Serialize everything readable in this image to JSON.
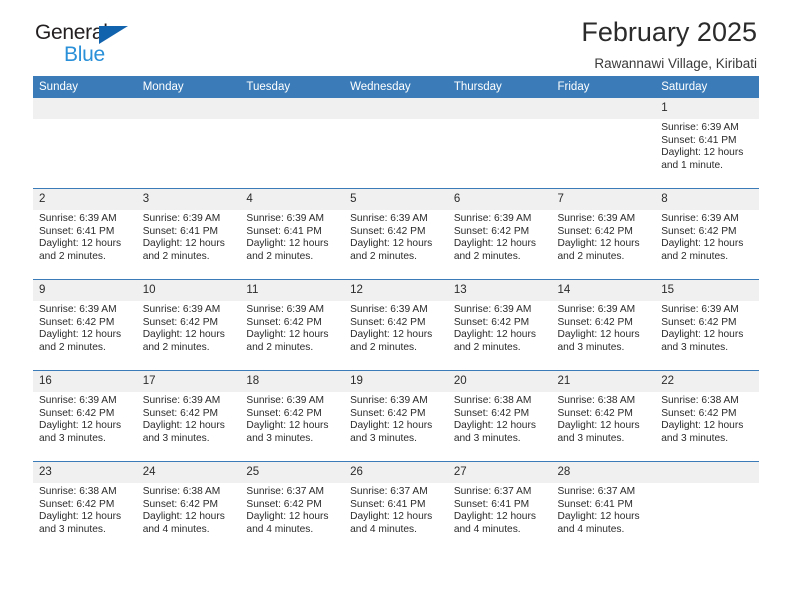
{
  "logo": {
    "word1": "General",
    "word2": "Blue",
    "triangle_color": "#1263ad",
    "word2_color": "#2a90d8"
  },
  "header": {
    "title": "February 2025",
    "subtitle": "Rawannawi Village, Kiribati"
  },
  "theme": {
    "header_blue": "#3b7cb8",
    "daynum_band": "#f0f0f0",
    "text": "#2b2b2b"
  },
  "calendar": {
    "weekday_headers": [
      "Sunday",
      "Monday",
      "Tuesday",
      "Wednesday",
      "Thursday",
      "Friday",
      "Saturday"
    ],
    "weeks": [
      [
        {
          "day": "",
          "sunrise": "",
          "sunset": "",
          "daylight": "",
          "daylight2": ""
        },
        {
          "day": "",
          "sunrise": "",
          "sunset": "",
          "daylight": "",
          "daylight2": ""
        },
        {
          "day": "",
          "sunrise": "",
          "sunset": "",
          "daylight": "",
          "daylight2": ""
        },
        {
          "day": "",
          "sunrise": "",
          "sunset": "",
          "daylight": "",
          "daylight2": ""
        },
        {
          "day": "",
          "sunrise": "",
          "sunset": "",
          "daylight": "",
          "daylight2": ""
        },
        {
          "day": "",
          "sunrise": "",
          "sunset": "",
          "daylight": "",
          "daylight2": ""
        },
        {
          "day": "1",
          "sunrise": "Sunrise: 6:39 AM",
          "sunset": "Sunset: 6:41 PM",
          "daylight": "Daylight: 12 hours",
          "daylight2": "and 1 minute."
        }
      ],
      [
        {
          "day": "2",
          "sunrise": "Sunrise: 6:39 AM",
          "sunset": "Sunset: 6:41 PM",
          "daylight": "Daylight: 12 hours",
          "daylight2": "and 2 minutes."
        },
        {
          "day": "3",
          "sunrise": "Sunrise: 6:39 AM",
          "sunset": "Sunset: 6:41 PM",
          "daylight": "Daylight: 12 hours",
          "daylight2": "and 2 minutes."
        },
        {
          "day": "4",
          "sunrise": "Sunrise: 6:39 AM",
          "sunset": "Sunset: 6:41 PM",
          "daylight": "Daylight: 12 hours",
          "daylight2": "and 2 minutes."
        },
        {
          "day": "5",
          "sunrise": "Sunrise: 6:39 AM",
          "sunset": "Sunset: 6:42 PM",
          "daylight": "Daylight: 12 hours",
          "daylight2": "and 2 minutes."
        },
        {
          "day": "6",
          "sunrise": "Sunrise: 6:39 AM",
          "sunset": "Sunset: 6:42 PM",
          "daylight": "Daylight: 12 hours",
          "daylight2": "and 2 minutes."
        },
        {
          "day": "7",
          "sunrise": "Sunrise: 6:39 AM",
          "sunset": "Sunset: 6:42 PM",
          "daylight": "Daylight: 12 hours",
          "daylight2": "and 2 minutes."
        },
        {
          "day": "8",
          "sunrise": "Sunrise: 6:39 AM",
          "sunset": "Sunset: 6:42 PM",
          "daylight": "Daylight: 12 hours",
          "daylight2": "and 2 minutes."
        }
      ],
      [
        {
          "day": "9",
          "sunrise": "Sunrise: 6:39 AM",
          "sunset": "Sunset: 6:42 PM",
          "daylight": "Daylight: 12 hours",
          "daylight2": "and 2 minutes."
        },
        {
          "day": "10",
          "sunrise": "Sunrise: 6:39 AM",
          "sunset": "Sunset: 6:42 PM",
          "daylight": "Daylight: 12 hours",
          "daylight2": "and 2 minutes."
        },
        {
          "day": "11",
          "sunrise": "Sunrise: 6:39 AM",
          "sunset": "Sunset: 6:42 PM",
          "daylight": "Daylight: 12 hours",
          "daylight2": "and 2 minutes."
        },
        {
          "day": "12",
          "sunrise": "Sunrise: 6:39 AM",
          "sunset": "Sunset: 6:42 PM",
          "daylight": "Daylight: 12 hours",
          "daylight2": "and 2 minutes."
        },
        {
          "day": "13",
          "sunrise": "Sunrise: 6:39 AM",
          "sunset": "Sunset: 6:42 PM",
          "daylight": "Daylight: 12 hours",
          "daylight2": "and 2 minutes."
        },
        {
          "day": "14",
          "sunrise": "Sunrise: 6:39 AM",
          "sunset": "Sunset: 6:42 PM",
          "daylight": "Daylight: 12 hours",
          "daylight2": "and 3 minutes."
        },
        {
          "day": "15",
          "sunrise": "Sunrise: 6:39 AM",
          "sunset": "Sunset: 6:42 PM",
          "daylight": "Daylight: 12 hours",
          "daylight2": "and 3 minutes."
        }
      ],
      [
        {
          "day": "16",
          "sunrise": "Sunrise: 6:39 AM",
          "sunset": "Sunset: 6:42 PM",
          "daylight": "Daylight: 12 hours",
          "daylight2": "and 3 minutes."
        },
        {
          "day": "17",
          "sunrise": "Sunrise: 6:39 AM",
          "sunset": "Sunset: 6:42 PM",
          "daylight": "Daylight: 12 hours",
          "daylight2": "and 3 minutes."
        },
        {
          "day": "18",
          "sunrise": "Sunrise: 6:39 AM",
          "sunset": "Sunset: 6:42 PM",
          "daylight": "Daylight: 12 hours",
          "daylight2": "and 3 minutes."
        },
        {
          "day": "19",
          "sunrise": "Sunrise: 6:39 AM",
          "sunset": "Sunset: 6:42 PM",
          "daylight": "Daylight: 12 hours",
          "daylight2": "and 3 minutes."
        },
        {
          "day": "20",
          "sunrise": "Sunrise: 6:38 AM",
          "sunset": "Sunset: 6:42 PM",
          "daylight": "Daylight: 12 hours",
          "daylight2": "and 3 minutes."
        },
        {
          "day": "21",
          "sunrise": "Sunrise: 6:38 AM",
          "sunset": "Sunset: 6:42 PM",
          "daylight": "Daylight: 12 hours",
          "daylight2": "and 3 minutes."
        },
        {
          "day": "22",
          "sunrise": "Sunrise: 6:38 AM",
          "sunset": "Sunset: 6:42 PM",
          "daylight": "Daylight: 12 hours",
          "daylight2": "and 3 minutes."
        }
      ],
      [
        {
          "day": "23",
          "sunrise": "Sunrise: 6:38 AM",
          "sunset": "Sunset: 6:42 PM",
          "daylight": "Daylight: 12 hours",
          "daylight2": "and 3 minutes."
        },
        {
          "day": "24",
          "sunrise": "Sunrise: 6:38 AM",
          "sunset": "Sunset: 6:42 PM",
          "daylight": "Daylight: 12 hours",
          "daylight2": "and 4 minutes."
        },
        {
          "day": "25",
          "sunrise": "Sunrise: 6:37 AM",
          "sunset": "Sunset: 6:42 PM",
          "daylight": "Daylight: 12 hours",
          "daylight2": "and 4 minutes."
        },
        {
          "day": "26",
          "sunrise": "Sunrise: 6:37 AM",
          "sunset": "Sunset: 6:41 PM",
          "daylight": "Daylight: 12 hours",
          "daylight2": "and 4 minutes."
        },
        {
          "day": "27",
          "sunrise": "Sunrise: 6:37 AM",
          "sunset": "Sunset: 6:41 PM",
          "daylight": "Daylight: 12 hours",
          "daylight2": "and 4 minutes."
        },
        {
          "day": "28",
          "sunrise": "Sunrise: 6:37 AM",
          "sunset": "Sunset: 6:41 PM",
          "daylight": "Daylight: 12 hours",
          "daylight2": "and 4 minutes."
        },
        {
          "day": "",
          "sunrise": "",
          "sunset": "",
          "daylight": "",
          "daylight2": ""
        }
      ]
    ]
  }
}
